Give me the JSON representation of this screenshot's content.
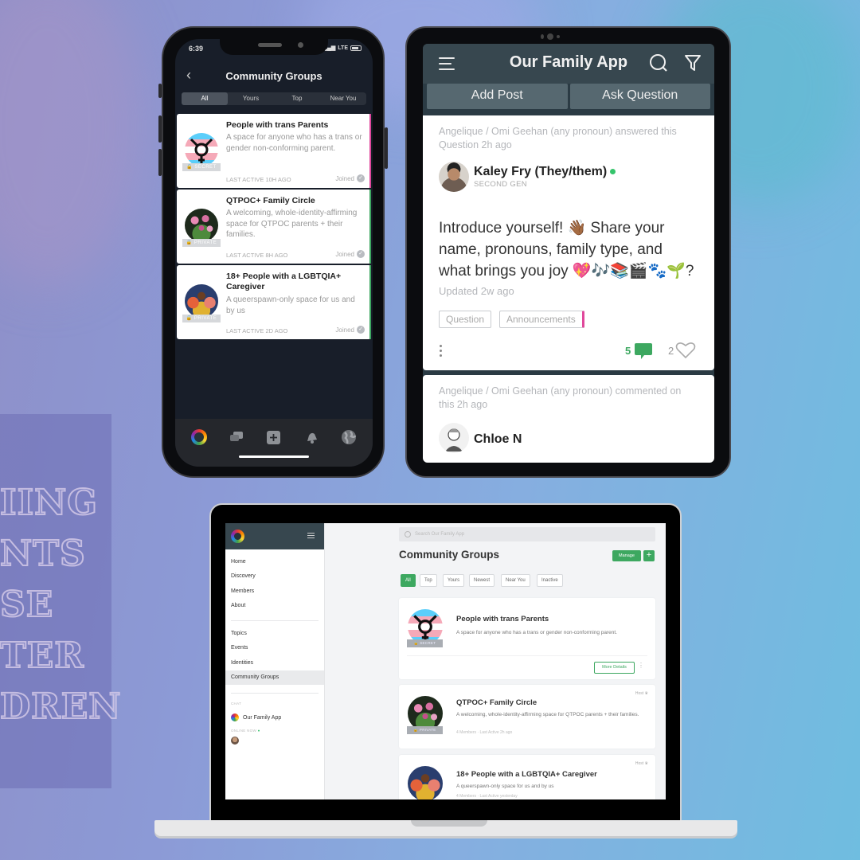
{
  "background": {
    "sign_lines": [
      "IING",
      "NTS",
      "SE",
      "TER",
      "DREN"
    ]
  },
  "phone": {
    "status": {
      "time": "6:39",
      "network": "LTE"
    },
    "header": {
      "title": "Community Groups",
      "back_icon": "chevron-left-icon"
    },
    "tabs": [
      {
        "label": "All",
        "active": true
      },
      {
        "label": "Yours",
        "active": false
      },
      {
        "label": "Top",
        "active": false
      },
      {
        "label": "Near You",
        "active": false
      }
    ],
    "groups": [
      {
        "name": "People with trans Parents",
        "description": "A space for anyone who has a trans or gender non-conforming parent.",
        "privacy": "SECRET",
        "last_active": "LAST ACTIVE 10H AGO",
        "status": "Joined",
        "accent_color": "#e0489b"
      },
      {
        "name": "QTPOC+ Family Circle",
        "description": "A welcoming, whole-identity-affirming space for QTPOC parents + their families.",
        "privacy": "PRIVATE",
        "last_active": "LAST ACTIVE 8H AGO",
        "status": "Joined",
        "accent_color": "#3da860"
      },
      {
        "name": "18+ People with a LGBTQIA+ Caregiver",
        "description": "A queerspawn-only space for us and by us",
        "privacy": "PRIVATE",
        "last_active": "LAST ACTIVE 2D AGO",
        "status": "Joined",
        "accent_color": "#3da860"
      }
    ],
    "bottom_nav": [
      "app-logo-icon",
      "chat-icon",
      "add-icon",
      "bell-icon",
      "globe-icon"
    ]
  },
  "tablet": {
    "header": {
      "title": "Our Family App"
    },
    "actions": {
      "add_post": "Add Post",
      "ask_question": "Ask Question"
    },
    "posts": [
      {
        "activity": "Angelique / Omi Geehan (any pronoun) answered this Question 2h ago",
        "author": "Kaley Fry (They/them)",
        "online": true,
        "role": "SECOND GEN",
        "body": "Introduce yourself! 👋🏾 Share your name, pronouns, family type, and what brings you joy 💖🎶📚🎬🐾🌱?",
        "updated": "Updated 2w ago",
        "tags": [
          "Question",
          "Announcements"
        ],
        "comments": "5",
        "likes": "2"
      },
      {
        "activity": "Angelique / Omi Geehan (any pronoun) commented on this 2h ago",
        "author": "Chloe N"
      }
    ],
    "colors": {
      "header": "#37474f",
      "green": "#3da860",
      "pink": "#e0489b"
    }
  },
  "laptop": {
    "sidebar": {
      "primary": [
        "Home",
        "Discovery",
        "Members",
        "About"
      ],
      "secondary": [
        "Topics",
        "Events",
        "Identities",
        "Community Groups"
      ],
      "active": "Community Groups",
      "chat_label": "CHAT",
      "chat_item": "Our Family App",
      "online_label": "ONLINE NOW"
    },
    "search_placeholder": "Search Our Family App",
    "title": "Community Groups",
    "manage_label": "Manage",
    "add_label": "+",
    "filters": [
      {
        "label": "All",
        "active": true
      },
      {
        "label": "Top",
        "active": false
      },
      {
        "label": "Yours",
        "active": false
      },
      {
        "label": "Newest",
        "active": false
      },
      {
        "label": "Near You",
        "active": false
      },
      {
        "label": "Inactive",
        "active": false
      }
    ],
    "groups": [
      {
        "name": "People with trans Parents",
        "description": "A space for anyone who has a trans or gender non-conforming parent.",
        "privacy": "SECRET",
        "more_label": "More Details"
      },
      {
        "name": "QTPOC+ Family Circle",
        "description": "A welcoming, whole-identity-affirming space for QTPOC parents + their families.",
        "privacy": "PRIVATE",
        "meta": "4 Members · Last Active 2h ago",
        "role": "Host"
      },
      {
        "name": "18+ People with a LGBTQIA+ Caregiver",
        "description": "A queerspawn-only space for us and by us",
        "privacy": "PRIVATE",
        "meta": "4 Members · Last Active yesterday",
        "role": "Host"
      }
    ]
  }
}
